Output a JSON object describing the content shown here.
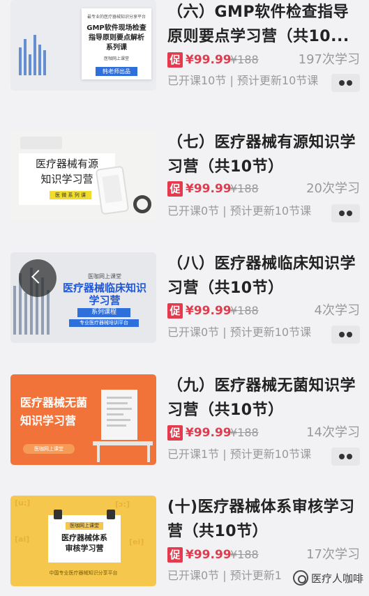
{
  "courses": [
    {
      "title": "（六）GMP软件检查指导原则要点学习营（共10...",
      "promo_badge": "促",
      "price": "¥99.99",
      "original_price": "¥188",
      "learn_count": "197次学习",
      "progress": "已开课10节 | 预计更新10节课",
      "thumb": {
        "lines": [
          "最专业的医疗器械知识分享平台",
          "GMP软件现场检查",
          "指导原则要点解析",
          "系列课",
          "医咖网上课堂"
        ],
        "tag": "韩老师出品"
      }
    },
    {
      "title": "（七）医疗器械有源知识学习营（共10节）",
      "promo_badge": "促",
      "price": "¥99.99",
      "original_price": "¥188",
      "learn_count": "20次学习",
      "progress": "已开课0节 | 预计更新10节课",
      "thumb": {
        "lines": [
          "医疗器械有源",
          "知识学习营"
        ],
        "tag": "医 微 系 列 课"
      }
    },
    {
      "title": "（八）医疗器械临床知识学习营（共10节）",
      "promo_badge": "促",
      "price": "¥99.99",
      "original_price": "¥188",
      "learn_count": "4次学习",
      "progress": "已开课0节 | 预计更新10节课",
      "thumb": {
        "lines": [
          "医咖网上课堂",
          "医疗器械临床知识",
          "学习营",
          "专业医疗器械培训平台"
        ],
        "tag": "系列课程"
      }
    },
    {
      "title": "（九）医疗器械无菌知识学习营（共10节）",
      "promo_badge": "促",
      "price": "¥99.99",
      "original_price": "¥188",
      "learn_count": "14次学习",
      "progress": "已开课1节 | 预计更新10节课",
      "thumb": {
        "lines": [
          "医疗器械无菌",
          "知识学习营"
        ],
        "tag": "医咖网上课堂"
      }
    },
    {
      "title": "(十)医疗器械体系审核学习营（共10节）",
      "promo_badge": "促",
      "price": "¥99.99",
      "original_price": "¥188",
      "learn_count": "17次学习",
      "progress": "已开课0节 | 预计更新1",
      "thumb": {
        "lines": [
          "医疗器械体系",
          "审核学习营",
          "中国专业医疗器械知识分享平台"
        ],
        "tag": "医咖网上课堂"
      }
    }
  ],
  "watermark": {
    "icon": "wechat-channel-icon",
    "text": "医疗人咖啡"
  },
  "colors": {
    "accent": "#e33a4d",
    "muted": "#999999",
    "background": "#f2f2f4"
  }
}
